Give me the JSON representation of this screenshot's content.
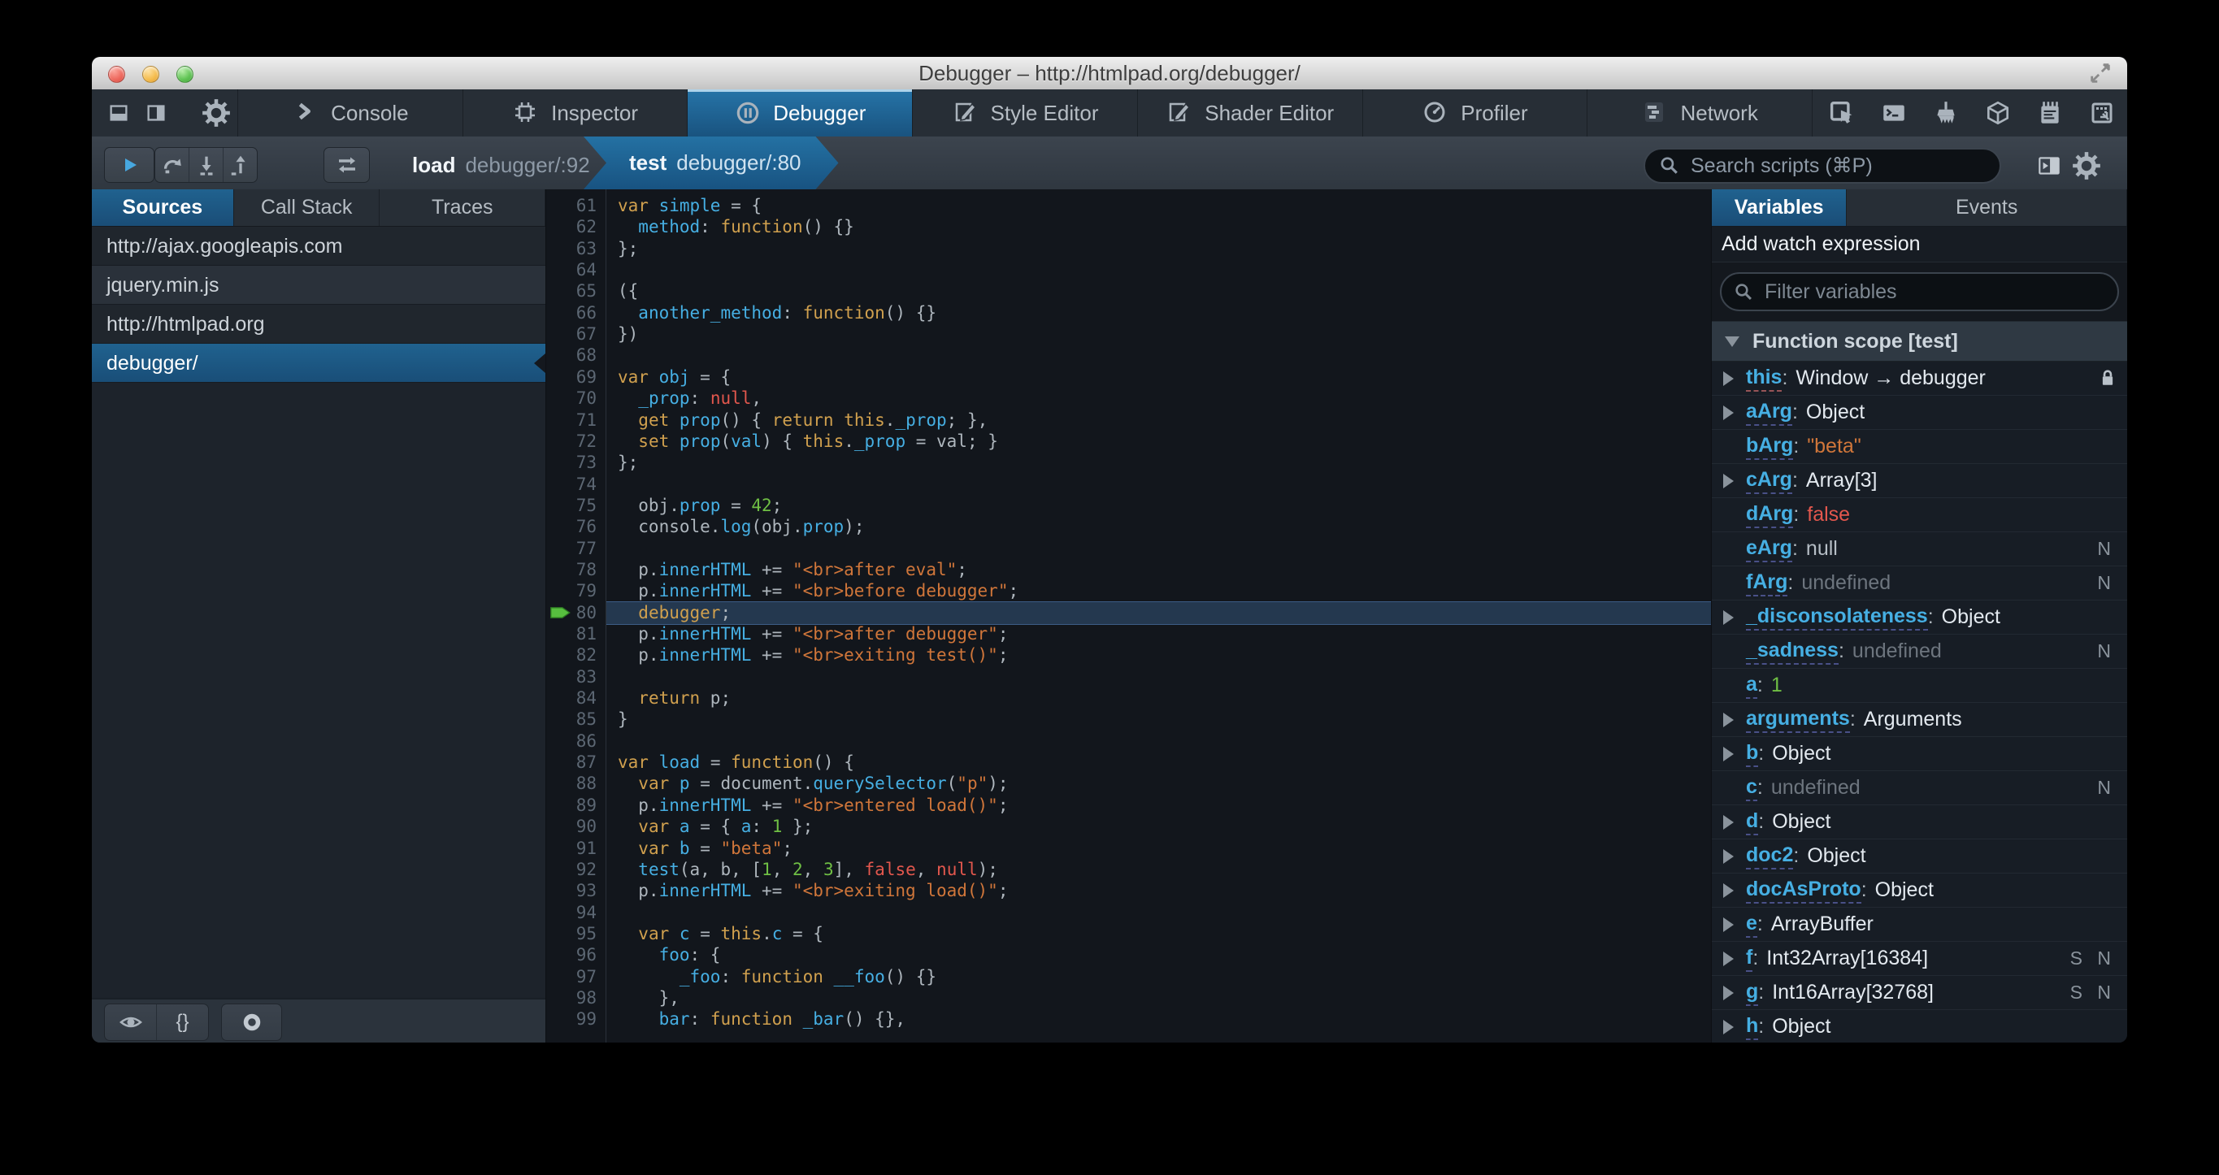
{
  "colors": {
    "accent_blue": "#46afe3",
    "tab_active_blue": "#2174a6",
    "exec_line_green": "#57bf3f",
    "close_light": "#ee6a5f",
    "minimize_light": "#f5bd4f",
    "zoom_light": "#61c455"
  },
  "window": {
    "title": "Debugger – http://htmlpad.org/debugger/",
    "controls": [
      "close",
      "minimize",
      "zoom"
    ]
  },
  "tabbar": {
    "left_controls": [
      {
        "icon": "dock-bottom-icon"
      },
      {
        "icon": "dock-side-icon"
      },
      {
        "icon": "gear-icon"
      }
    ],
    "tabs": [
      {
        "id": "console",
        "label": "Console",
        "icon": "console-icon",
        "active": false
      },
      {
        "id": "inspector",
        "label": "Inspector",
        "icon": "inspector-icon",
        "active": false
      },
      {
        "id": "debugger",
        "label": "Debugger",
        "icon": "debugger-icon",
        "active": true
      },
      {
        "id": "style-editor",
        "label": "Style Editor",
        "icon": "style-editor-icon",
        "active": false
      },
      {
        "id": "shader-editor",
        "label": "Shader Editor",
        "icon": "shader-editor-icon",
        "active": false
      },
      {
        "id": "profiler",
        "label": "Profiler",
        "icon": "profiler-icon",
        "active": false
      },
      {
        "id": "network",
        "label": "Network",
        "icon": "network-icon",
        "active": false
      }
    ],
    "toolbox_buttons": [
      {
        "icon": "pick-element-icon"
      },
      {
        "icon": "split-console-icon"
      },
      {
        "icon": "paintbrush-icon"
      },
      {
        "icon": "box-model-icon"
      },
      {
        "icon": "scratchpad-icon"
      },
      {
        "icon": "responsive-mode-icon"
      }
    ]
  },
  "toolbar": {
    "buttons": [
      {
        "icon": "resume-icon",
        "name": "resume-button"
      },
      {
        "icon": "step-over-icon",
        "name": "step-over-button"
      },
      {
        "icon": "step-in-icon",
        "name": "step-in-button"
      },
      {
        "icon": "step-out-icon",
        "name": "step-out-button"
      },
      {
        "icon": "blackbox-icon",
        "name": "toggle-blackbox-button"
      }
    ],
    "frames": [
      {
        "fn": "load",
        "loc": "debugger/:92",
        "active": false
      },
      {
        "fn": "test",
        "loc": "debugger/:80",
        "active": true
      }
    ],
    "search_placeholder": "Search scripts (⌘P)"
  },
  "sidebar": {
    "tabs": [
      {
        "label": "Sources",
        "active": true
      },
      {
        "label": "Call Stack",
        "active": false
      },
      {
        "label": "Traces",
        "active": false
      }
    ],
    "sources": [
      {
        "label": "http://ajax.googleapis.com",
        "kind": "header"
      },
      {
        "label": "jquery.min.js",
        "kind": "item"
      },
      {
        "label": "http://htmlpad.org",
        "kind": "header"
      },
      {
        "label": "debugger/",
        "kind": "selected"
      }
    ],
    "footer": {
      "blackbox_label": "{}",
      "buttons": [
        {
          "icon": "eye-icon",
          "name": "toggle-blackbox-source-button"
        },
        {
          "icon": "braces",
          "name": "pretty-print-button"
        },
        {
          "icon": "record-icon",
          "name": "pause-on-exceptions-button"
        }
      ]
    }
  },
  "editor": {
    "current_line": 80,
    "lines": [
      {
        "n": 61,
        "t": [
          [
            "k",
            "var"
          ],
          [
            "p",
            " "
          ],
          [
            "d",
            "simple"
          ],
          [
            "p",
            " = {"
          ]
        ]
      },
      {
        "n": 62,
        "t": [
          [
            "p",
            "  "
          ],
          [
            "d",
            "method"
          ],
          [
            "p",
            ": "
          ],
          [
            "k",
            "function"
          ],
          [
            "p",
            "() {}"
          ]
        ]
      },
      {
        "n": 63,
        "t": [
          [
            "p",
            "};"
          ]
        ]
      },
      {
        "n": 64,
        "t": []
      },
      {
        "n": 65,
        "t": [
          [
            "p",
            "({"
          ]
        ]
      },
      {
        "n": 66,
        "t": [
          [
            "p",
            "  "
          ],
          [
            "d",
            "another_method"
          ],
          [
            "p",
            ": "
          ],
          [
            "k",
            "function"
          ],
          [
            "p",
            "() {}"
          ]
        ]
      },
      {
        "n": 67,
        "t": [
          [
            "p",
            "})"
          ]
        ]
      },
      {
        "n": 68,
        "t": []
      },
      {
        "n": 69,
        "t": [
          [
            "k",
            "var"
          ],
          [
            "p",
            " "
          ],
          [
            "d",
            "obj"
          ],
          [
            "p",
            " = {"
          ]
        ]
      },
      {
        "n": 70,
        "t": [
          [
            "p",
            "  "
          ],
          [
            "d",
            "_prop"
          ],
          [
            "p",
            ": "
          ],
          [
            "a",
            "null"
          ],
          [
            "p",
            ","
          ]
        ]
      },
      {
        "n": 71,
        "t": [
          [
            "p",
            "  "
          ],
          [
            "k",
            "get"
          ],
          [
            "p",
            " "
          ],
          [
            "d",
            "prop"
          ],
          [
            "p",
            "() { "
          ],
          [
            "k",
            "return"
          ],
          [
            "p",
            " "
          ],
          [
            "k",
            "this"
          ],
          [
            "p",
            "."
          ],
          [
            "d",
            "_prop"
          ],
          [
            "p",
            "; },"
          ]
        ]
      },
      {
        "n": 72,
        "t": [
          [
            "p",
            "  "
          ],
          [
            "k",
            "set"
          ],
          [
            "p",
            " "
          ],
          [
            "d",
            "prop"
          ],
          [
            "p",
            "("
          ],
          [
            "d",
            "val"
          ],
          [
            "p",
            ") { "
          ],
          [
            "k",
            "this"
          ],
          [
            "p",
            "."
          ],
          [
            "d",
            "_prop"
          ],
          [
            "p",
            " = val; }"
          ]
        ]
      },
      {
        "n": 73,
        "t": [
          [
            "p",
            "};"
          ]
        ]
      },
      {
        "n": 74,
        "t": []
      },
      {
        "n": 75,
        "t": [
          [
            "p",
            "  obj."
          ],
          [
            "d",
            "prop"
          ],
          [
            "p",
            " = "
          ],
          [
            "n",
            "42"
          ],
          [
            "p",
            ";"
          ]
        ]
      },
      {
        "n": 76,
        "t": [
          [
            "p",
            "  console."
          ],
          [
            "d",
            "log"
          ],
          [
            "p",
            "(obj."
          ],
          [
            "d",
            "prop"
          ],
          [
            "p",
            ");"
          ]
        ]
      },
      {
        "n": 77,
        "t": []
      },
      {
        "n": 78,
        "t": [
          [
            "p",
            "  p."
          ],
          [
            "d",
            "innerHTML"
          ],
          [
            "p",
            " += "
          ],
          [
            "s",
            "\"<br>after eval\""
          ],
          [
            "p",
            ";"
          ]
        ]
      },
      {
        "n": 79,
        "t": [
          [
            "p",
            "  p."
          ],
          [
            "d",
            "innerHTML"
          ],
          [
            "p",
            " += "
          ],
          [
            "s",
            "\"<br>before debugger\""
          ],
          [
            "p",
            ";"
          ]
        ]
      },
      {
        "n": 80,
        "t": [
          [
            "p",
            "  "
          ],
          [
            "k",
            "debugger"
          ],
          [
            "p",
            ";"
          ]
        ]
      },
      {
        "n": 81,
        "t": [
          [
            "p",
            "  p."
          ],
          [
            "d",
            "innerHTML"
          ],
          [
            "p",
            " += "
          ],
          [
            "s",
            "\"<br>after debugger\""
          ],
          [
            "p",
            ";"
          ]
        ]
      },
      {
        "n": 82,
        "t": [
          [
            "p",
            "  p."
          ],
          [
            "d",
            "innerHTML"
          ],
          [
            "p",
            " += "
          ],
          [
            "s",
            "\"<br>exiting test()\""
          ],
          [
            "p",
            ";"
          ]
        ]
      },
      {
        "n": 83,
        "t": []
      },
      {
        "n": 84,
        "t": [
          [
            "p",
            "  "
          ],
          [
            "k",
            "return"
          ],
          [
            "p",
            " p;"
          ]
        ]
      },
      {
        "n": 85,
        "t": [
          [
            "p",
            "}"
          ]
        ]
      },
      {
        "n": 86,
        "t": []
      },
      {
        "n": 87,
        "t": [
          [
            "k",
            "var"
          ],
          [
            "p",
            " "
          ],
          [
            "d",
            "load"
          ],
          [
            "p",
            " = "
          ],
          [
            "k",
            "function"
          ],
          [
            "p",
            "() {"
          ]
        ]
      },
      {
        "n": 88,
        "t": [
          [
            "p",
            "  "
          ],
          [
            "k",
            "var"
          ],
          [
            "p",
            " "
          ],
          [
            "d",
            "p"
          ],
          [
            "p",
            " = document."
          ],
          [
            "d",
            "querySelector"
          ],
          [
            "p",
            "("
          ],
          [
            "s",
            "\"p\""
          ],
          [
            "p",
            ");"
          ]
        ]
      },
      {
        "n": 89,
        "t": [
          [
            "p",
            "  p."
          ],
          [
            "d",
            "innerHTML"
          ],
          [
            "p",
            " += "
          ],
          [
            "s",
            "\"<br>entered load()\""
          ],
          [
            "p",
            ";"
          ]
        ]
      },
      {
        "n": 90,
        "t": [
          [
            "p",
            "  "
          ],
          [
            "k",
            "var"
          ],
          [
            "p",
            " "
          ],
          [
            "d",
            "a"
          ],
          [
            "p",
            " = { "
          ],
          [
            "d",
            "a"
          ],
          [
            "p",
            ": "
          ],
          [
            "n",
            "1"
          ],
          [
            "p",
            " };"
          ]
        ]
      },
      {
        "n": 91,
        "t": [
          [
            "p",
            "  "
          ],
          [
            "k",
            "var"
          ],
          [
            "p",
            " "
          ],
          [
            "d",
            "b"
          ],
          [
            "p",
            " = "
          ],
          [
            "s",
            "\"beta\""
          ],
          [
            "p",
            ";"
          ]
        ]
      },
      {
        "n": 92,
        "t": [
          [
            "p",
            "  "
          ],
          [
            "d",
            "test"
          ],
          [
            "p",
            "(a, b, ["
          ],
          [
            "n",
            "1"
          ],
          [
            "p",
            ", "
          ],
          [
            "n",
            "2"
          ],
          [
            "p",
            ", "
          ],
          [
            "n",
            "3"
          ],
          [
            "p",
            "], "
          ],
          [
            "a",
            "false"
          ],
          [
            "p",
            ", "
          ],
          [
            "a",
            "null"
          ],
          [
            "p",
            ");"
          ]
        ]
      },
      {
        "n": 93,
        "t": [
          [
            "p",
            "  p."
          ],
          [
            "d",
            "innerHTML"
          ],
          [
            "p",
            " += "
          ],
          [
            "s",
            "\"<br>exiting load()\""
          ],
          [
            "p",
            ";"
          ]
        ]
      },
      {
        "n": 94,
        "t": []
      },
      {
        "n": 95,
        "t": [
          [
            "p",
            "  "
          ],
          [
            "k",
            "var"
          ],
          [
            "p",
            " "
          ],
          [
            "d",
            "c"
          ],
          [
            "p",
            " = "
          ],
          [
            "k",
            "this"
          ],
          [
            "p",
            "."
          ],
          [
            "d",
            "c"
          ],
          [
            "p",
            " = {"
          ]
        ]
      },
      {
        "n": 96,
        "t": [
          [
            "p",
            "    "
          ],
          [
            "d",
            "foo"
          ],
          [
            "p",
            ": {"
          ]
        ]
      },
      {
        "n": 97,
        "t": [
          [
            "p",
            "      "
          ],
          [
            "d",
            "_foo"
          ],
          [
            "p",
            ": "
          ],
          [
            "k",
            "function"
          ],
          [
            "p",
            " "
          ],
          [
            "d",
            "__foo"
          ],
          [
            "p",
            "() {}"
          ]
        ]
      },
      {
        "n": 98,
        "t": [
          [
            "p",
            "    },"
          ]
        ]
      },
      {
        "n": 99,
        "t": [
          [
            "p",
            "    "
          ],
          [
            "d",
            "bar"
          ],
          [
            "p",
            ": "
          ],
          [
            "k",
            "function"
          ],
          [
            "p",
            " "
          ],
          [
            "d",
            "_bar"
          ],
          [
            "p",
            "() {},"
          ]
        ]
      }
    ]
  },
  "variables": {
    "tabs": [
      {
        "label": "Variables",
        "active": true
      },
      {
        "label": "Events",
        "active": false
      }
    ],
    "watch_label": "Add watch expression",
    "filter_placeholder": "Filter variables",
    "scope_label": "Function scope [test]",
    "rows": [
      {
        "name": "this",
        "value": "Window → debugger",
        "vtype": "obj",
        "arrow": true,
        "lock": true,
        "this_mark": true
      },
      {
        "name": "aArg",
        "value": "Object",
        "vtype": "obj",
        "arrow": true
      },
      {
        "name": "bArg",
        "value": "\"beta\"",
        "vtype": "str",
        "arrow": false
      },
      {
        "name": "cArg",
        "value": "Array[3]",
        "vtype": "obj",
        "arrow": true
      },
      {
        "name": "dArg",
        "value": "false",
        "vtype": "bool",
        "arrow": false
      },
      {
        "name": "eArg",
        "value": "null",
        "vtype": "null",
        "arrow": false,
        "badge": "N"
      },
      {
        "name": "fArg",
        "value": "undefined",
        "vtype": "undef",
        "arrow": false,
        "badge": "N"
      },
      {
        "name": "_disconsolateness",
        "value": "Object",
        "vtype": "obj",
        "arrow": true
      },
      {
        "name": "_sadness",
        "value": "undefined",
        "vtype": "undef",
        "arrow": false,
        "badge": "N"
      },
      {
        "name": "a",
        "value": "1",
        "vtype": "num",
        "arrow": false
      },
      {
        "name": "arguments",
        "value": "Arguments",
        "vtype": "obj",
        "arrow": true
      },
      {
        "name": "b",
        "value": "Object",
        "vtype": "obj",
        "arrow": true
      },
      {
        "name": "c",
        "value": "undefined",
        "vtype": "undef",
        "arrow": false,
        "badge": "N"
      },
      {
        "name": "d",
        "value": "Object",
        "vtype": "obj",
        "arrow": true
      },
      {
        "name": "doc2",
        "value": "Object",
        "vtype": "obj",
        "arrow": true
      },
      {
        "name": "docAsProto",
        "value": "Object",
        "vtype": "obj",
        "arrow": true
      },
      {
        "name": "e",
        "value": "ArrayBuffer",
        "vtype": "obj",
        "arrow": true
      },
      {
        "name": "f",
        "value": "Int32Array[16384]",
        "vtype": "obj",
        "arrow": true,
        "badge": "S N"
      },
      {
        "name": "g",
        "value": "Int16Array[32768]",
        "vtype": "obj",
        "arrow": true,
        "badge": "S N"
      },
      {
        "name": "h",
        "value": "Object",
        "vtype": "obj",
        "arrow": true
      }
    ]
  }
}
